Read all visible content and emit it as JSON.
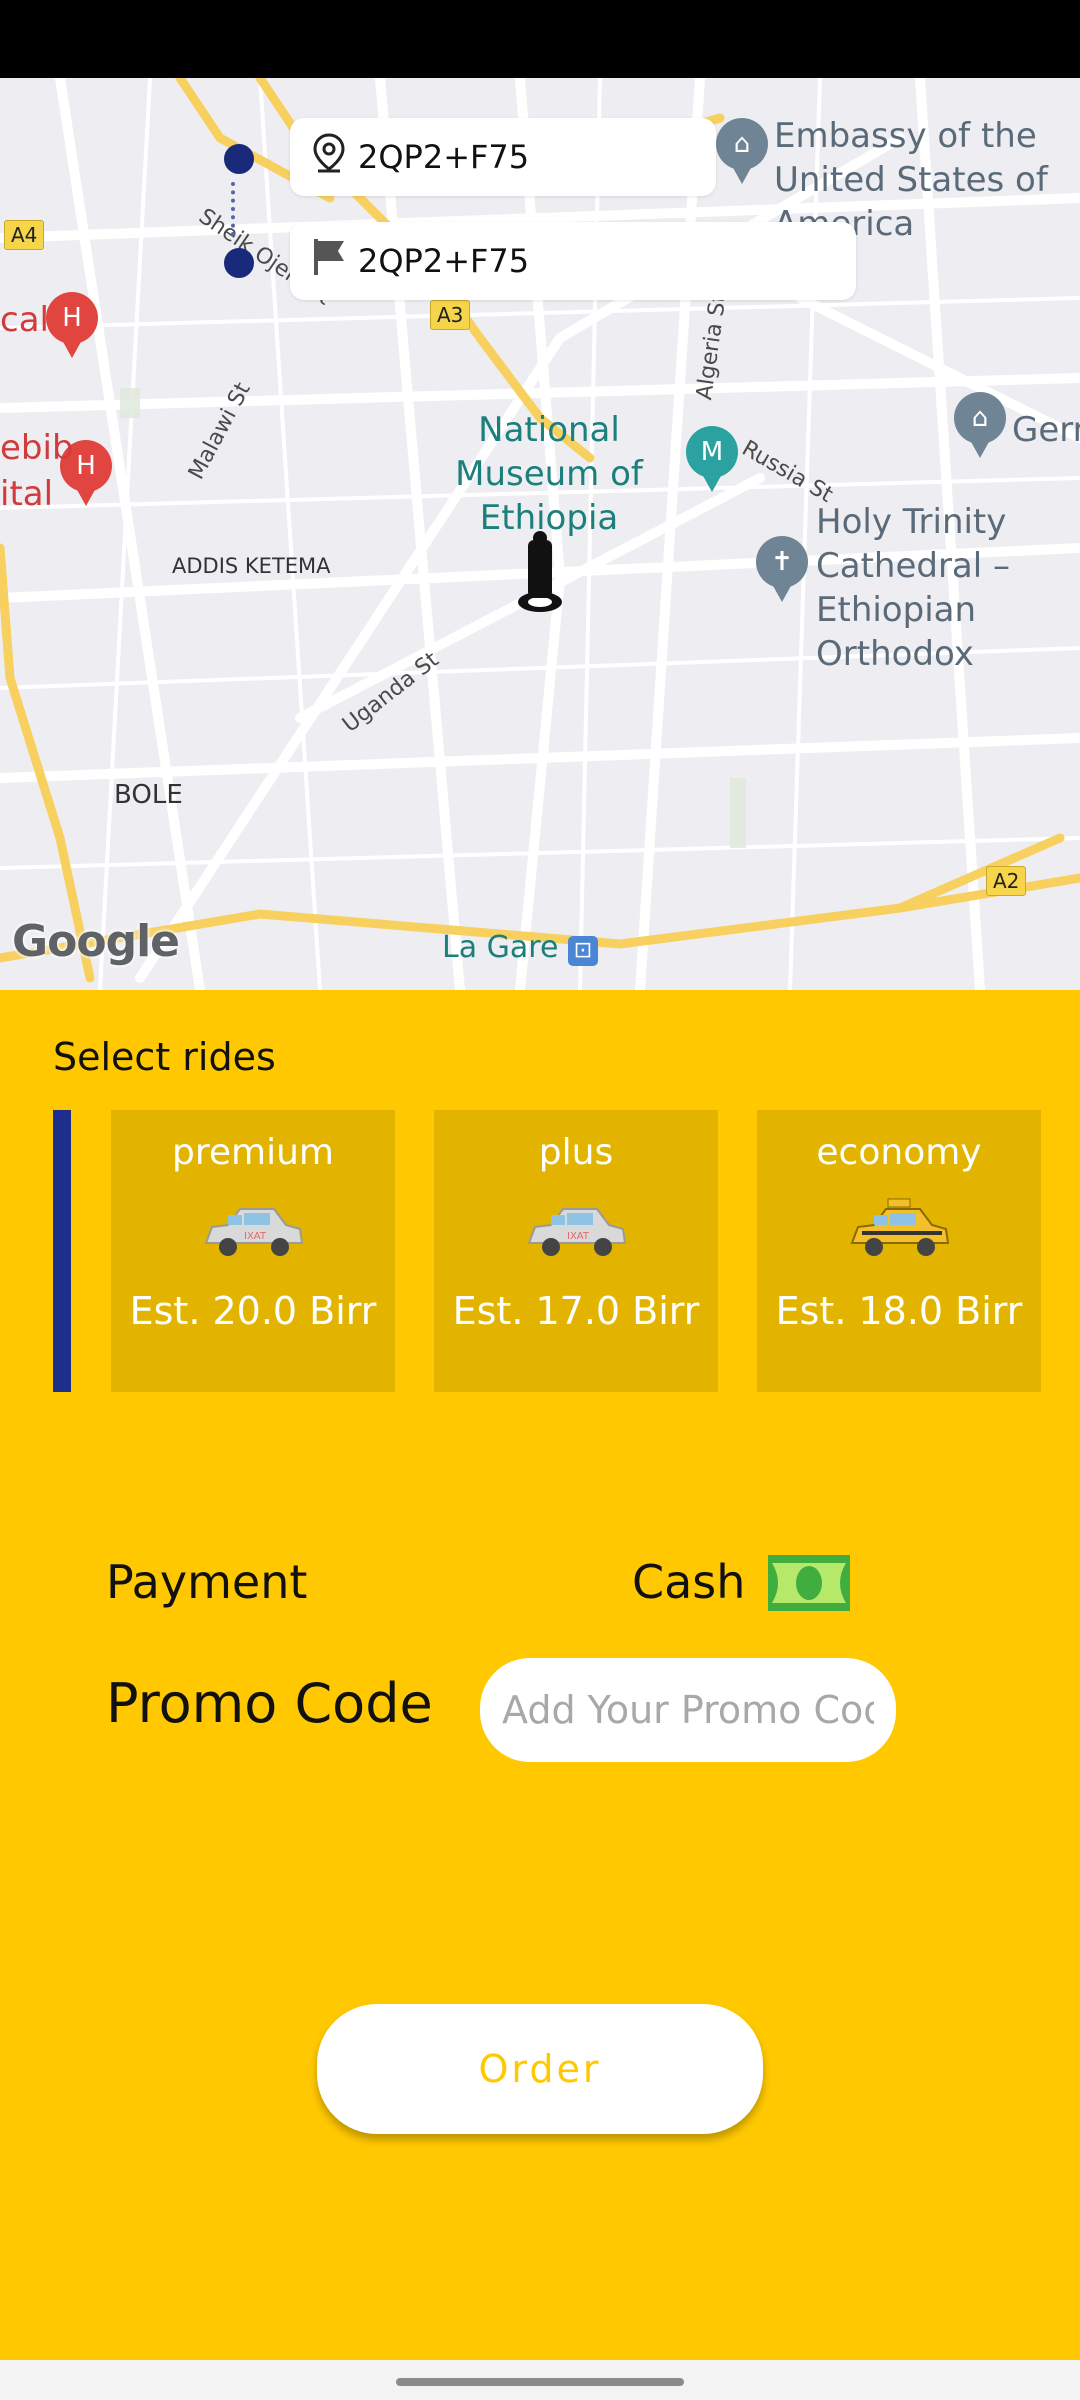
{
  "map": {
    "labels": {
      "embassy": "Embassy of the United States of America",
      "museum": "National Museum of Ethiopia",
      "trinity": "Holy Trinity Cathedral – Ethiopian Orthodox",
      "germany": "Germ",
      "hospital1": "cal",
      "hospital2a": "ebib",
      "hospital2b": "ital",
      "addis_ketema": "ADDIS KETEMA",
      "bole": "BOLE",
      "la_gare": "La Gare",
      "malawi": "Malawi St",
      "uganda": "Uganda St",
      "algeria": "Algeria St",
      "russia": "Russia St",
      "sheik": "Sheik Ojele St"
    },
    "road_shields": {
      "a4": "A4",
      "a3": "A3",
      "a2": "A2"
    },
    "google": "Google"
  },
  "route": {
    "pickup": {
      "icon": "map-pin-icon",
      "value": "2QP2+F75"
    },
    "destination": {
      "icon": "flag-icon",
      "value": "2QP2+F75"
    }
  },
  "rides": {
    "title": "Select rides",
    "options": [
      {
        "name": "premium",
        "price": "Est. 20.0 Birr",
        "color": "#d9d9d9"
      },
      {
        "name": "plus",
        "price": "Est. 17.0 Birr",
        "color": "#d9d9d9"
      },
      {
        "name": "economy",
        "price": "Est. 18.0 Birr",
        "color": "#f4c02a"
      }
    ]
  },
  "payment": {
    "label": "Payment",
    "method": "Cash",
    "icon": "cash-icon"
  },
  "promo": {
    "label": "Promo Code",
    "placeholder": "Add Your Promo Code",
    "value": ""
  },
  "order": {
    "label": "Order"
  },
  "colors": {
    "accent": "#ffc800",
    "card": "#e2b400",
    "indicator": "#1d2f8a"
  }
}
